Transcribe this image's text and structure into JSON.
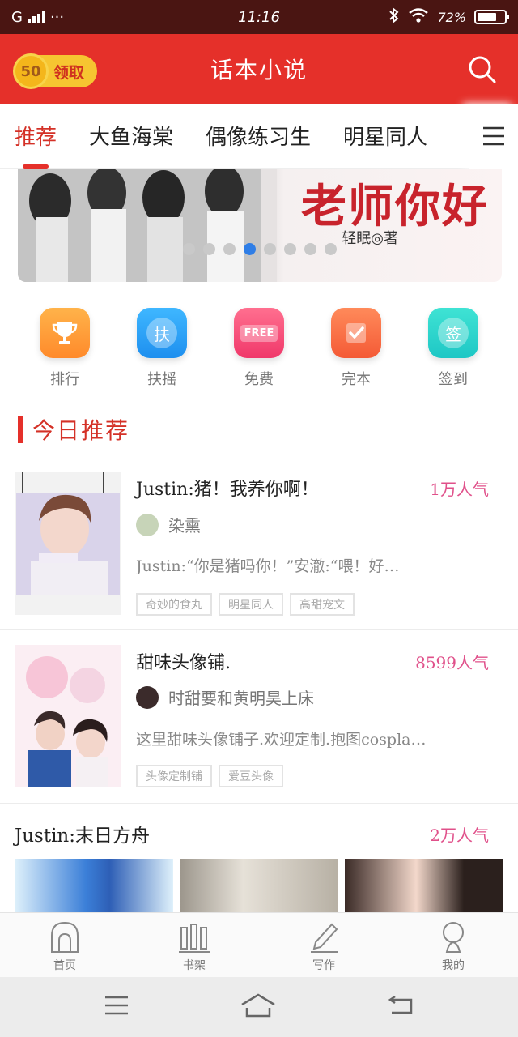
{
  "status_bar": {
    "carrier": "G",
    "more": "···",
    "time": "11:16",
    "battery": "72%",
    "battery_level": 0.72
  },
  "header": {
    "coin_value": "50",
    "coin_action": "领取",
    "title": "话本小说"
  },
  "tabs": [
    {
      "label": "推荐",
      "active": true
    },
    {
      "label": "大鱼海棠",
      "active": false
    },
    {
      "label": "偶像练习生",
      "active": false
    },
    {
      "label": "明星同人",
      "active": false
    }
  ],
  "banner": {
    "title": "老师你好",
    "author": "轻眠◎著",
    "slide_count": 8,
    "active_slide": 4
  },
  "quick_entries": [
    {
      "label": "排行",
      "icon": "trophy-icon",
      "glyph": "",
      "color_from": "#ffb34a",
      "color_to": "#ff8a2b"
    },
    {
      "label": "扶摇",
      "icon": "support-icon",
      "glyph": "扶",
      "color_from": "#3fb7ff",
      "color_to": "#1e8fef"
    },
    {
      "label": "免费",
      "icon": "free-icon",
      "glyph": "FREE",
      "color_from": "#ff6f8f",
      "color_to": "#f0386a"
    },
    {
      "label": "完本",
      "icon": "check-icon",
      "glyph": "",
      "color_from": "#ff8a5a",
      "color_to": "#f45a36"
    },
    {
      "label": "签到",
      "icon": "sign-in-icon",
      "glyph": "签",
      "color_from": "#3fe3d4",
      "color_to": "#1ec7c5"
    }
  ],
  "section": {
    "title": "今日推荐"
  },
  "books": [
    {
      "name": "Justin:猪！我养你啊！",
      "popularity": "1万人气",
      "author": "染熏",
      "description": "Justin:“你是猪吗你！”安澈:“喂！好…",
      "tags": [
        "奇妙的食丸",
        "明星同人",
        "高甜宠文"
      ]
    },
    {
      "name": "甜味头像铺.",
      "popularity": "8599人气",
      "author": "时甜要和黄明昊上床",
      "description": "这里甜味头像铺子.欢迎定制.抱图cospla…",
      "tags": [
        "头像定制铺",
        "爱豆头像"
      ]
    }
  ],
  "book3": {
    "name": "Justin:末日方舟",
    "popularity": "2万人气"
  },
  "bottom_nav": [
    {
      "label": "首页",
      "icon": "home-icon"
    },
    {
      "label": "书架",
      "icon": "bookshelf-icon"
    },
    {
      "label": "写作",
      "icon": "pencil-icon"
    },
    {
      "label": "我的",
      "icon": "profile-icon"
    }
  ],
  "colors": {
    "brand_red": "#e5302a",
    "popularity_pink": "#e0508a",
    "active_dot": "#2f7ee6"
  }
}
